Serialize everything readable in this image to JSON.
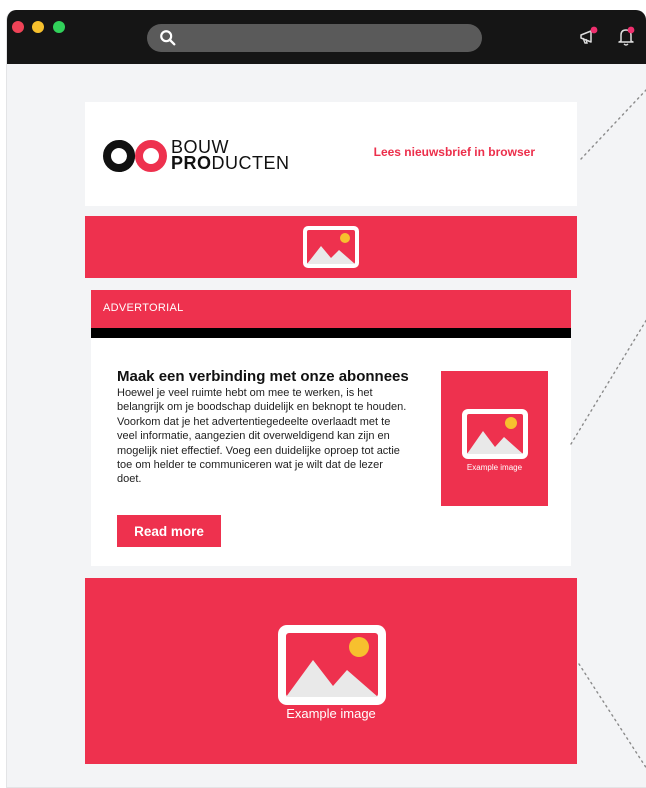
{
  "window": {
    "controls": [
      "close",
      "minimize",
      "maximize"
    ],
    "top_icons": [
      "megaphone-icon",
      "bell-icon"
    ]
  },
  "header": {
    "logo": {
      "line1": "BOUW",
      "line2_bold": "PRO",
      "line2_rest": "DUCTEN"
    },
    "browser_link": "Lees nieuwsbrief in browser"
  },
  "advertorial": {
    "label": "ADVERTORIAL",
    "title": "Maak een verbinding met onze abonnees",
    "body": "Hoewel je veel ruimte hebt om mee te werken, is het belangrijk om je boodschap duidelijk en beknopt te houden. Voorkom dat je het advertentiegedeelte overlaadt met te veel informatie, aangezien dit overweldigend kan zijn en mogelijk niet effectief. Voeg een duidelijke oproep tot actie toe om helder te communiceren wat je wilt dat de lezer doet.",
    "button": "Read more",
    "image_caption": "Example image"
  },
  "big_image": {
    "caption": "Example image"
  },
  "colors": {
    "accent": "#ee314e",
    "titlebar": "#151515",
    "background": "#f3f4f6"
  }
}
